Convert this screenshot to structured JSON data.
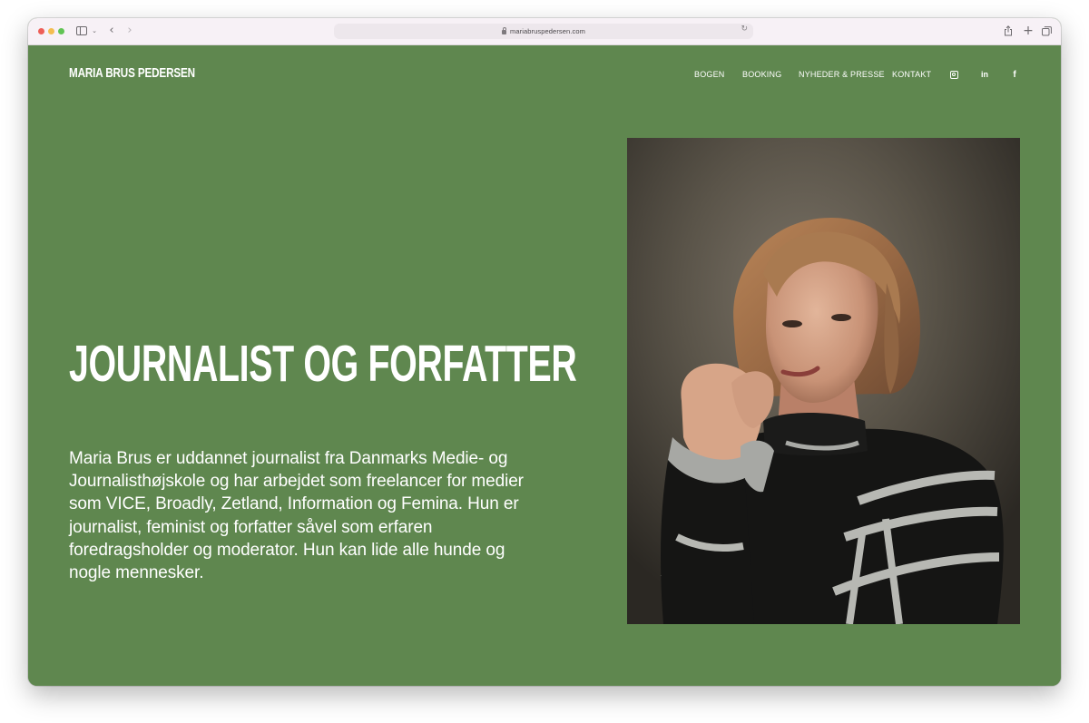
{
  "browser": {
    "url": "mariabruspedersen.com",
    "icons": {
      "sidebar": "sidebar-icon",
      "back": "chevron-left-icon",
      "forward": "chevron-right-icon",
      "reload": "reload-icon",
      "share": "share-icon",
      "new_tab": "plus-icon",
      "tabs": "tabs-icon"
    }
  },
  "site": {
    "brand": "MARIA BRUS PEDERSEN",
    "nav": [
      {
        "label": "BOGEN"
      },
      {
        "label": "BOOKING"
      },
      {
        "label": "NYHEDER & PRESSE"
      },
      {
        "label": "KONTAKT"
      }
    ],
    "social": {
      "instagram": "instagram-icon",
      "linkedin": "in",
      "facebook": "f"
    },
    "colors": {
      "background": "#5f874f",
      "text": "#ffffff"
    }
  },
  "hero": {
    "title": "JOURNALIST OG FORFATTER",
    "body": "Maria Brus er uddannet journalist fra Danmarks Medie- og Journalisthøjskole og har arbejdet som freelancer for medier som VICE, Broadly, Zetland, Information og Femina. Hun er journalist, feminist og forfatter såvel som erfaren foredragsholder og moderator. Hun kan lide alle hunde og nogle mennesker."
  }
}
